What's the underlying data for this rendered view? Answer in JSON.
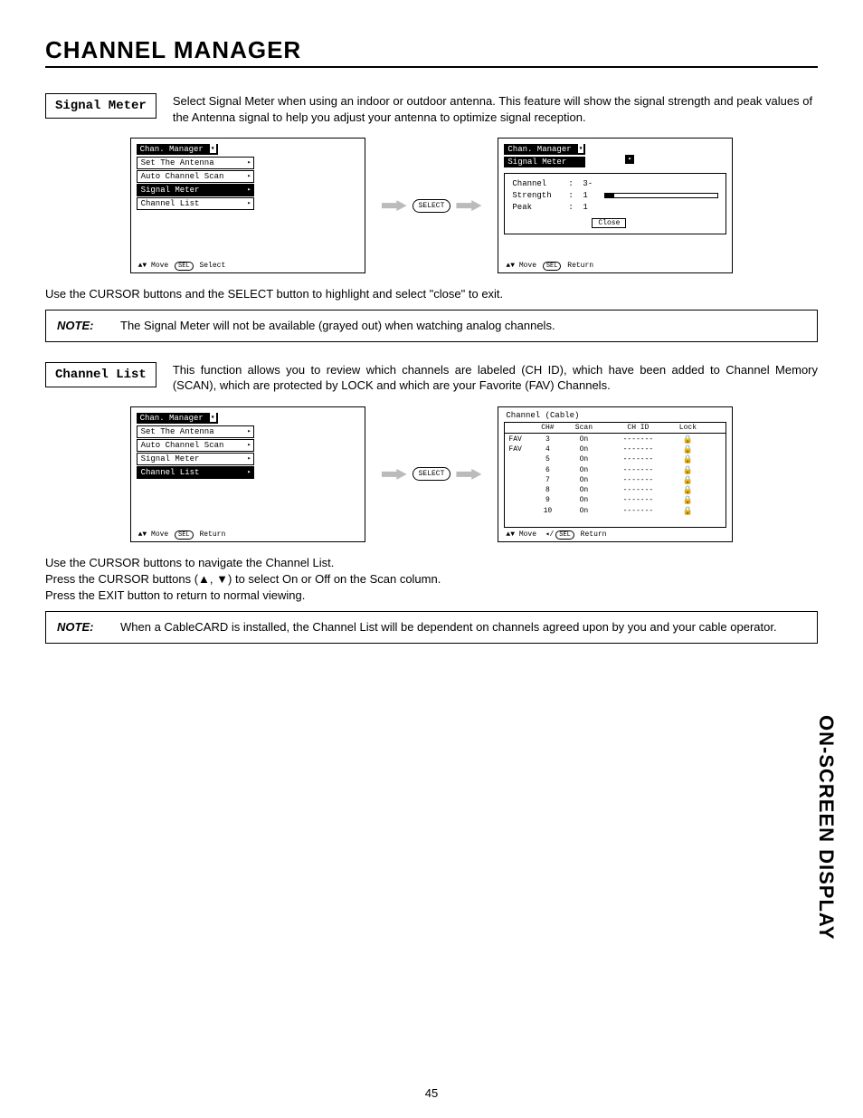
{
  "page": {
    "title": "CHANNEL MANAGER",
    "number": "45",
    "side_label": "ON-SCREEN DISPLAY"
  },
  "signal_meter": {
    "label": "Signal Meter",
    "description": "Select Signal Meter when using an indoor or outdoor antenna.  This feature will show the signal strength and peak values of the Antenna signal to help  you adjust your antenna to optimize signal reception.",
    "menu_title": "Chan. Manager",
    "menu_items": [
      "Set The Antenna",
      "Auto Channel Scan",
      "Signal Meter",
      "Channel List"
    ],
    "selected_index": 2,
    "footer_move": "Move",
    "footer_sel": "SEL",
    "footer_action": "Select",
    "select_button": "SELECT",
    "result_title": "Chan. Manager",
    "result_sub": "Signal Meter",
    "rows": {
      "channel_label": "Channel",
      "channel_value": "3-",
      "strength_label": "Strength",
      "strength_value": "1",
      "peak_label": "Peak",
      "peak_value": "1"
    },
    "close_label": "Close",
    "result_footer_action": "Return",
    "instructions": "Use the CURSOR buttons and the SELECT button to highlight and select \"close\" to exit.",
    "note_label": "NOTE:",
    "note_text": "The Signal Meter will not be available (grayed out) when watching analog channels."
  },
  "channel_list": {
    "label": "Channel List",
    "description": "This function allows you to review which channels are labeled (CH ID), which have been added to Channel Memory (SCAN), which are protected by LOCK and which are your Favorite (FAV) Channels.",
    "menu_title": "Chan. Manager",
    "menu_items": [
      "Set The Antenna",
      "Auto Channel Scan",
      "Signal Meter",
      "Channel List"
    ],
    "selected_index": 3,
    "footer_move": "Move",
    "footer_sel": "SEL",
    "footer_action": "Return",
    "select_button": "SELECT",
    "table_title": "Channel (Cable)",
    "columns": {
      "ch": "CH#",
      "scan": "Scan",
      "chid": "CH ID",
      "lock": "Lock"
    },
    "rows": [
      {
        "fav": "FAV",
        "ch": "3",
        "scan": "On",
        "chid": "-------",
        "lock": "🔒"
      },
      {
        "fav": "FAV",
        "ch": "4",
        "scan": "On",
        "chid": "-------",
        "lock": "🔒"
      },
      {
        "fav": "",
        "ch": "5",
        "scan": "On",
        "chid": "-------",
        "lock": "🔒"
      },
      {
        "fav": "",
        "ch": "6",
        "scan": "On",
        "chid": "-------",
        "lock": "🔒"
      },
      {
        "fav": "",
        "ch": "7",
        "scan": "On",
        "chid": "-------",
        "lock": "🔒"
      },
      {
        "fav": "",
        "ch": "8",
        "scan": "On",
        "chid": "-------",
        "lock": "🔒"
      },
      {
        "fav": "",
        "ch": "9",
        "scan": "On",
        "chid": "-------",
        "lock": "🔒"
      },
      {
        "fav": "",
        "ch": "10",
        "scan": "On",
        "chid": "-------",
        "lock": "🔒"
      }
    ],
    "table_footer_move": "Move",
    "table_footer_return": "Return",
    "instructions_1": "Use the CURSOR buttons to navigate the Channel List.",
    "instructions_2": "Press the CURSOR buttons (▲, ▼) to select On or Off on the Scan column.",
    "instructions_3": "Press the EXIT button to return to normal viewing.",
    "note_label": "NOTE:",
    "note_text": "When a CableCARD is installed, the Channel List will be dependent on channels agreed upon by you and your cable operator."
  }
}
